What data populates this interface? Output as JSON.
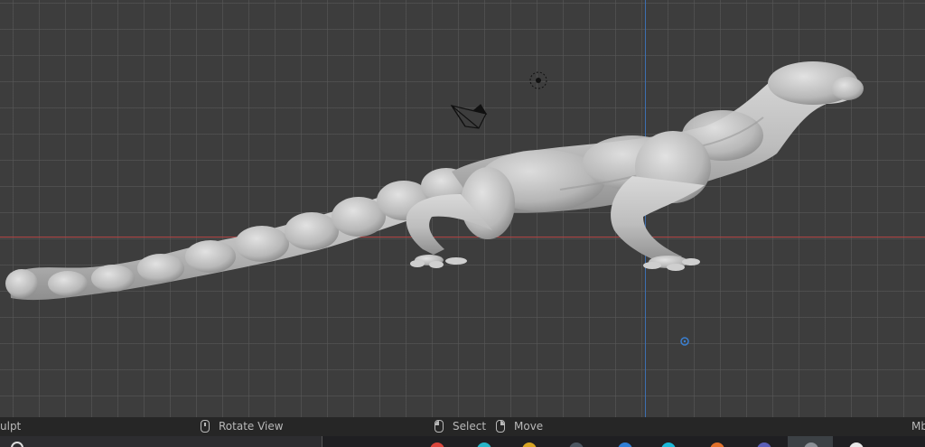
{
  "viewport": {
    "background": "#3d3d3d",
    "x_axis_color": "#b24545",
    "z_axis_color": "#3d6fb0",
    "model_color": "#c8c8c8",
    "camera_icon": "camera-icon",
    "light_icon": "light-icon",
    "origin_icon": "origin-marker-icon"
  },
  "statusbar": {
    "mode": "ulpt",
    "rotate_label": "Rotate View",
    "select_label": "Select",
    "move_label": "Move",
    "right_text": "Mb"
  },
  "taskbar": {
    "search_icon": "search-icon",
    "icons": [
      {
        "name": "taskbar-app-red-icon",
        "color": "#d9453b"
      },
      {
        "name": "taskbar-app-cyan-icon",
        "color": "#27b6c8"
      },
      {
        "name": "taskbar-app-yellow-icon",
        "color": "#d6a321"
      },
      {
        "name": "taskbar-app-slate-icon",
        "color": "#4b5560"
      },
      {
        "name": "taskbar-app-blue-icon",
        "color": "#2f7fd6"
      },
      {
        "name": "taskbar-app-teal-icon",
        "color": "#19b8d8"
      },
      {
        "name": "taskbar-app-orange-icon",
        "color": "#e0702a"
      },
      {
        "name": "taskbar-app-purple-icon",
        "color": "#5a5fb8"
      },
      {
        "name": "taskbar-app-grey-icon",
        "color": "#8a8f95"
      },
      {
        "name": "taskbar-app-white-icon",
        "color": "#e8e8e8"
      }
    ]
  }
}
